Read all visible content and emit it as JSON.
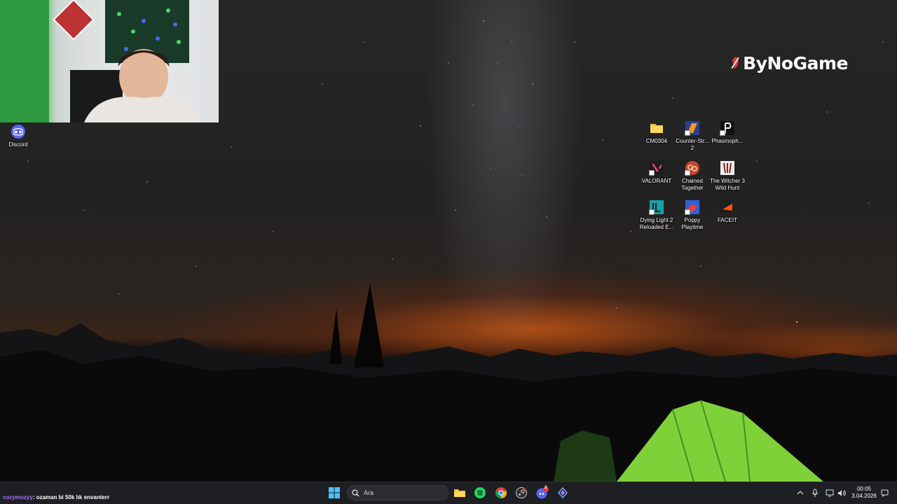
{
  "overlay": {
    "brand_name": "ByNoGame",
    "chat": {
      "username": "cozymozyy",
      "message": ": ozaman bi 50k lık envanterr"
    }
  },
  "desktop_icons": [
    {
      "label": "Discord",
      "icon": "discord-icon"
    },
    {
      "label": "CM0304",
      "icon": "folder-icon"
    },
    {
      "label": "Counter-Str... 2",
      "icon": "counter-strike-icon"
    },
    {
      "label": "Phasmoph...",
      "icon": "phasmophobia-icon"
    },
    {
      "label": "VALORANT",
      "icon": "valorant-icon"
    },
    {
      "label": "Chained Together",
      "icon": "chained-together-icon"
    },
    {
      "label": "The Witcher 3 Wild Hunt",
      "icon": "witcher-icon"
    },
    {
      "label": "Dying Light 2 Reloaded E...",
      "icon": "dying-light-icon"
    },
    {
      "label": "Poppy Playtime",
      "icon": "poppy-playtime-icon"
    },
    {
      "label": "FACEIT",
      "icon": "faceit-icon"
    }
  ],
  "taskbar": {
    "search_placeholder": "Ara",
    "pinned": [
      "start-icon",
      "file-explorer-icon",
      "spotify-icon",
      "chrome-icon",
      "steam-icon",
      "discord-icon",
      "app-icon"
    ],
    "discord_badge": "3",
    "clock": {
      "time": "00:05",
      "date": "3.04.2026"
    }
  },
  "colors": {
    "taskbar": "#1e1f22",
    "chat_user": "#a970ff",
    "tent": "#7fd13a",
    "brand_accent": "#e53935"
  }
}
